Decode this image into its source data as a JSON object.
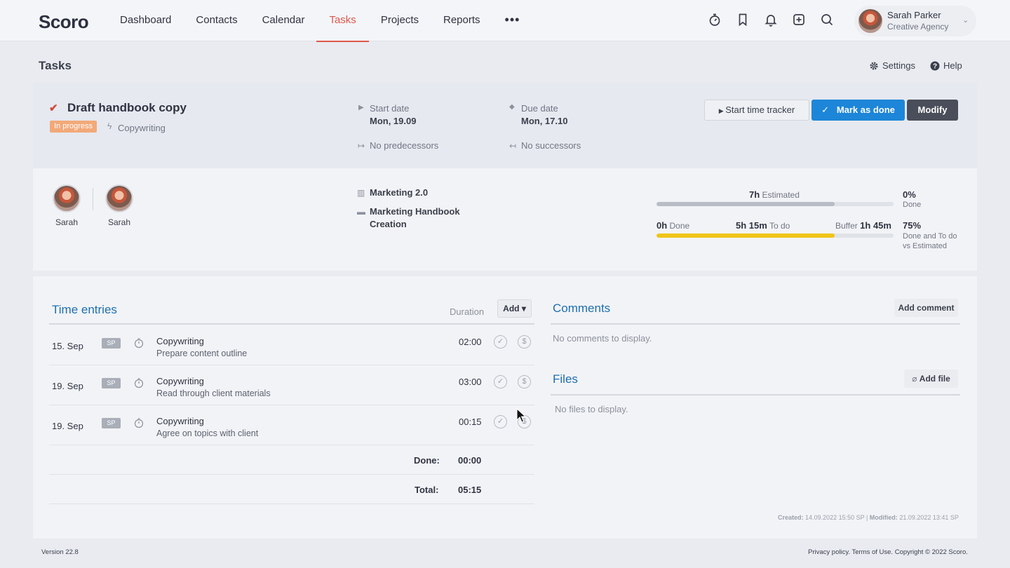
{
  "app": {
    "logo": "Scoro"
  },
  "nav": {
    "items": [
      "Dashboard",
      "Contacts",
      "Calendar",
      "Tasks",
      "Projects",
      "Reports"
    ],
    "more": "•••",
    "active_index": 3
  },
  "user": {
    "name": "Sarah Parker",
    "org": "Creative Agency"
  },
  "page": {
    "title": "Tasks",
    "settings": "Settings",
    "help": "Help"
  },
  "task": {
    "title": "Draft handbook copy",
    "status": "In progress",
    "category": "Copywriting",
    "start_label": "Start date",
    "start_value": "Mon, 19.09",
    "due_label": "Due date",
    "due_value": "Mon, 17.10",
    "predecessors": "No predecessors",
    "successors": "No successors",
    "btn_tracker": "Start time tracker",
    "btn_done": "Mark as done",
    "btn_modify": "Modify"
  },
  "people": [
    {
      "name": "Sarah"
    },
    {
      "name": "Sarah"
    }
  ],
  "project": {
    "line1": "Marketing 2.0",
    "line2a": "Marketing Handbook",
    "line2b": "Creation"
  },
  "progress": {
    "estimated_value": "7h",
    "estimated_label": "Estimated",
    "estimated_fill": 0.75,
    "done_pct": "0%",
    "done_pct_label": "Done",
    "done_value": "0h",
    "done_label": "Done",
    "todo_value": "5h 15m",
    "todo_label": "To do",
    "buffer_label": "Buffer",
    "buffer_value": "1h 45m",
    "todo_fill": 0.75,
    "ratio_pct": "75%",
    "ratio_label_1": "Done and To do",
    "ratio_label_2": "vs Estimated",
    "colors": {
      "estimated_bar": "#b7bcc6",
      "todo_bar": "#f0c419"
    }
  },
  "time_entries": {
    "title": "Time entries",
    "duration_header": "Duration",
    "add_label": "Add ▾",
    "rows": [
      {
        "date": "15. Sep",
        "badge": "SP",
        "title": "Copywriting",
        "desc": "Prepare content outline",
        "duration": "02:00"
      },
      {
        "date": "19. Sep",
        "badge": "SP",
        "title": "Copywriting",
        "desc": "Read through client materials",
        "duration": "03:00"
      },
      {
        "date": "19. Sep",
        "badge": "SP",
        "title": "Copywriting",
        "desc": "Agree on topics with client",
        "duration": "00:15"
      }
    ],
    "done_label": "Done:",
    "done_value": "00:00",
    "total_label": "Total:",
    "total_value": "05:15"
  },
  "comments": {
    "title": "Comments",
    "add_label": "Add comment",
    "empty": "No comments to display."
  },
  "files": {
    "title": "Files",
    "add_label": "Add file",
    "empty": "No files to display."
  },
  "meta": {
    "created_label": "Created:",
    "created_value": "14.09.2022 15:50 SP",
    "modified_label": "Modified:",
    "modified_value": "21.09.2022 13:41 SP"
  },
  "footer": {
    "version": "Version 22.8",
    "links": "Privacy policy. Terms of Use. Copyright © 2022 Scoro."
  }
}
